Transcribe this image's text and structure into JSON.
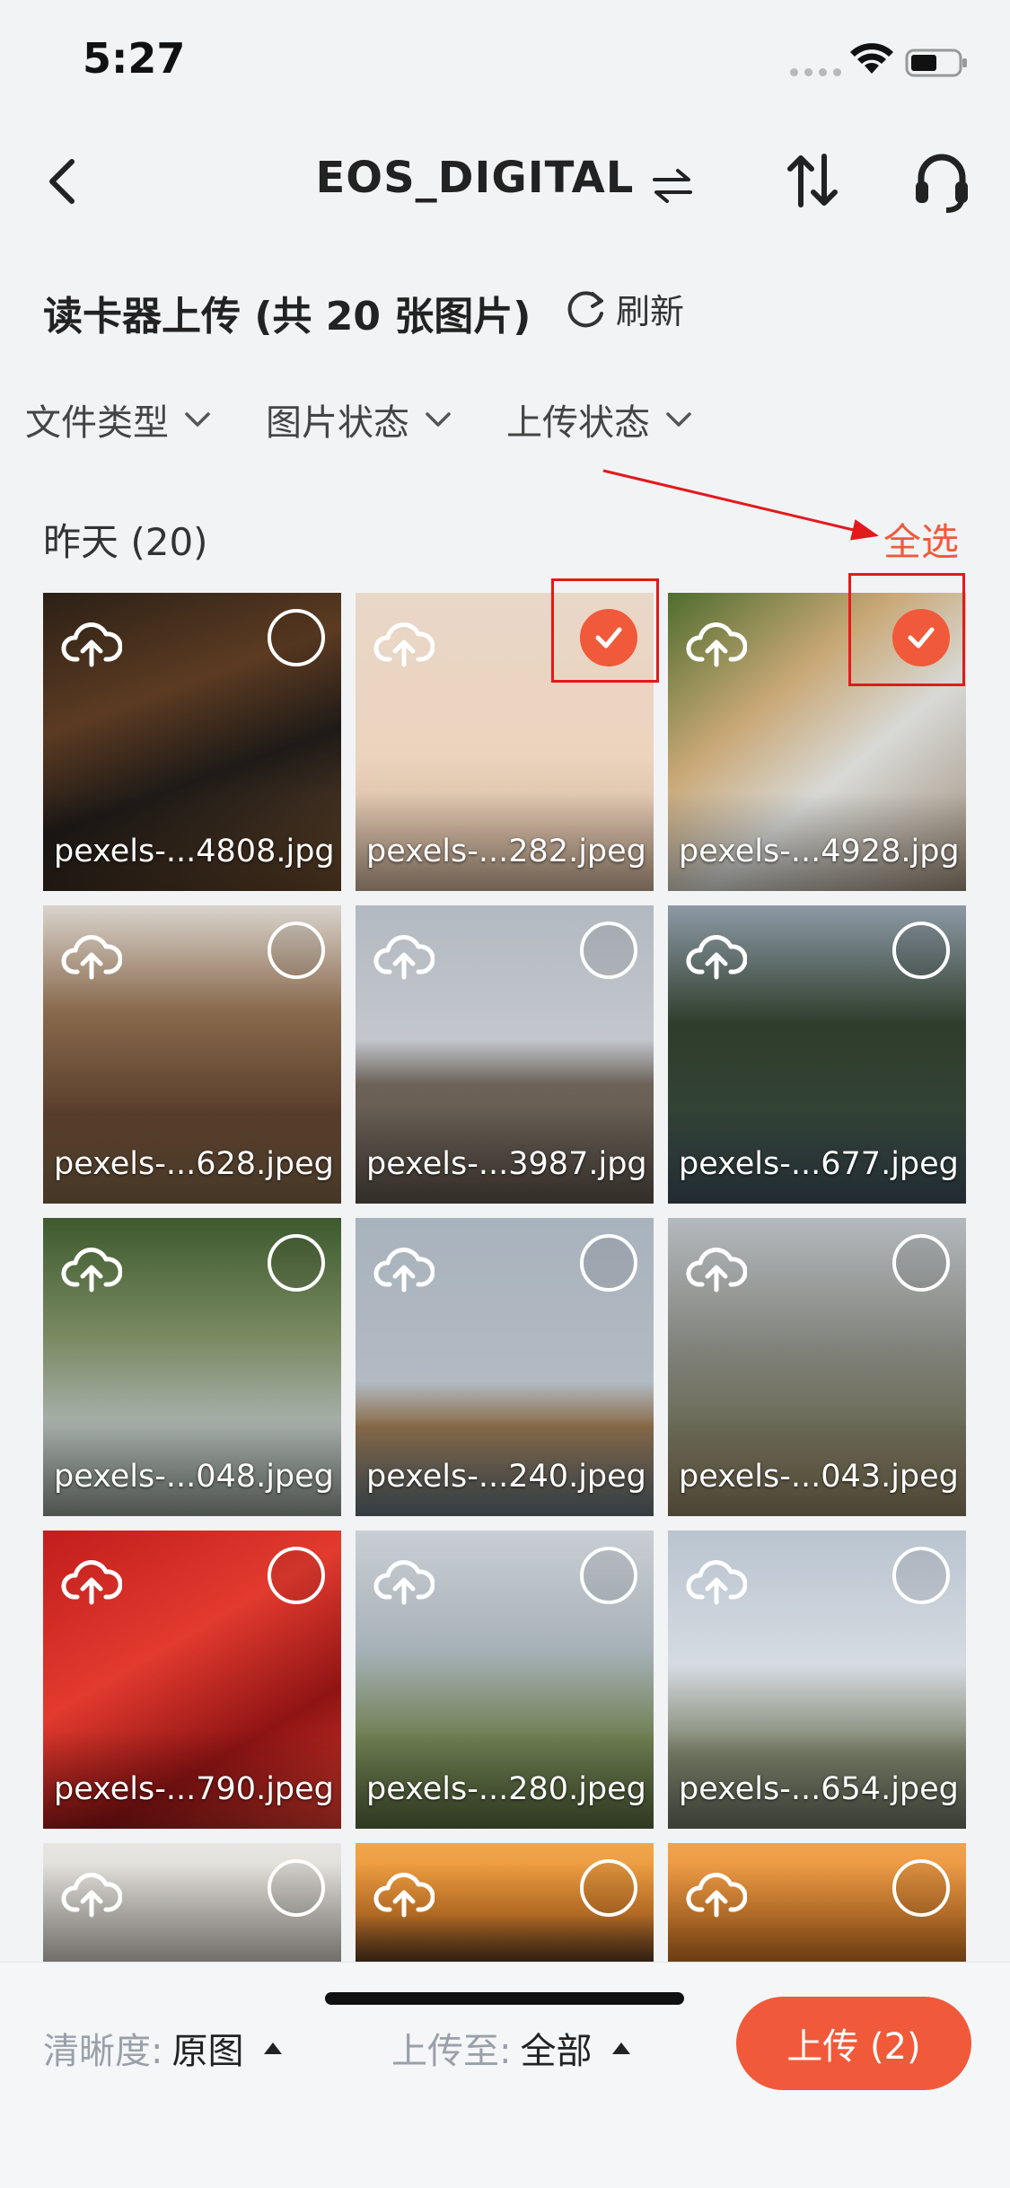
{
  "status": {
    "time": "5:27"
  },
  "nav": {
    "title": "EOS_DIGITAL"
  },
  "header": {
    "title": "读卡器上传 (共 20 张图片)",
    "refresh_label": "刷新"
  },
  "filters": [
    {
      "label": "文件类型"
    },
    {
      "label": "图片状态"
    },
    {
      "label": "上传状态"
    }
  ],
  "group": {
    "date_label": "昨天 (20)",
    "select_all": "全选"
  },
  "photos": [
    {
      "filename": "pexels-...4808.jpg",
      "selected": false
    },
    {
      "filename": "pexels-...282.jpeg",
      "selected": true
    },
    {
      "filename": "pexels-...4928.jpg",
      "selected": true
    },
    {
      "filename": "pexels-...628.jpeg",
      "selected": false
    },
    {
      "filename": "pexels-...3987.jpg",
      "selected": false
    },
    {
      "filename": "pexels-...677.jpeg",
      "selected": false
    },
    {
      "filename": "pexels-...048.jpeg",
      "selected": false
    },
    {
      "filename": "pexels-...240.jpeg",
      "selected": false
    },
    {
      "filename": "pexels-...043.jpeg",
      "selected": false
    },
    {
      "filename": "pexels-...790.jpeg",
      "selected": false
    },
    {
      "filename": "pexels-...280.jpeg",
      "selected": false
    },
    {
      "filename": "pexels-...654.jpeg",
      "selected": false
    },
    {
      "filename": "",
      "selected": false
    },
    {
      "filename": "",
      "selected": false
    },
    {
      "filename": "",
      "selected": false
    }
  ],
  "bottom": {
    "clarity_label": "清晰度:",
    "clarity_value": "原图",
    "destination_label": "上传至:",
    "destination_value": "全部",
    "upload_button": "上传 (2)"
  },
  "colors": {
    "accent": "#f05a3a",
    "annotation": "#e3191b"
  }
}
